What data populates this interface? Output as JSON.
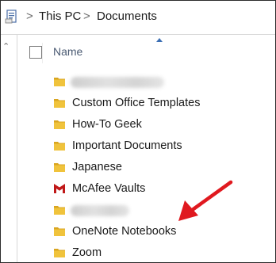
{
  "breadcrumb": {
    "items": [
      "This PC",
      "Documents"
    ],
    "separator": ">"
  },
  "header": {
    "name_label": "Name",
    "sort": "ascending"
  },
  "rows": [
    {
      "label": "",
      "icon": "folder-icon",
      "redacted": true
    },
    {
      "label": "Custom Office Templates",
      "icon": "folder-icon"
    },
    {
      "label": "How-To Geek",
      "icon": "folder-icon"
    },
    {
      "label": "Important Documents",
      "icon": "folder-icon"
    },
    {
      "label": "Japanese",
      "icon": "folder-icon"
    },
    {
      "label": "McAfee Vaults",
      "icon": "mcafee-icon"
    },
    {
      "label": "",
      "icon": "folder-icon",
      "redacted": true
    },
    {
      "label": "OneNote Notebooks",
      "icon": "folder-icon"
    },
    {
      "label": "Zoom",
      "icon": "folder-icon"
    }
  ],
  "colors": {
    "folder": "#f0c33c",
    "folder_dark": "#d9a520",
    "mcafee": "#c01818",
    "annotation_arrow": "#e0191f",
    "sort_arrow": "#3c6fb4"
  }
}
